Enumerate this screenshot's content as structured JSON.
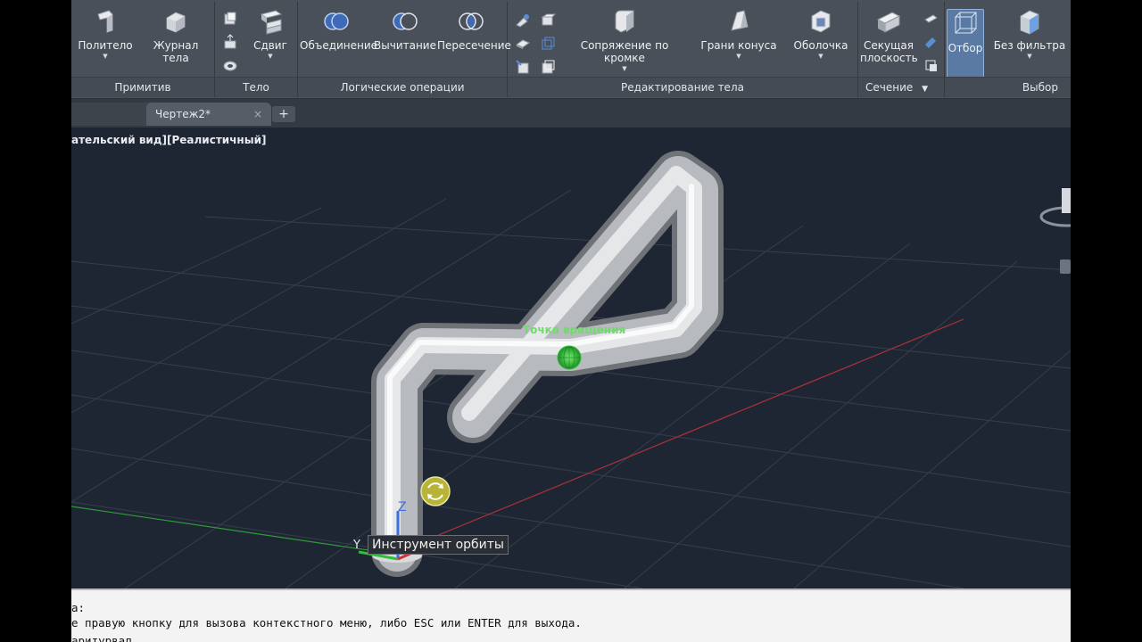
{
  "ribbon": {
    "groups": {
      "primitives": "Примитив",
      "solid": "Тело",
      "boolean": "Логические операции",
      "solid_editing": "Редактирование тела",
      "section": "Сечение",
      "selection": "Выбор"
    },
    "buttons": {
      "polysolid": "Политело",
      "solid_history": "Журнал тела",
      "sweep": "Сдвиг",
      "union": "Объединение",
      "subtract": "Вычитание",
      "intersect": "Пересечение",
      "fillet_edge": "Сопряжение по кромке",
      "taper_faces": "Грани конуса",
      "shell": "Оболочка",
      "section_plane_1": "Секущая",
      "section_plane_2": "плоскость",
      "culling": "Отбор",
      "no_filter": "Без фильтра"
    }
  },
  "tabs": {
    "current": "Чертеж2*",
    "close_glyph": "×",
    "new_glyph": "+"
  },
  "viewport": {
    "label": "ательский вид][Реалистичный]",
    "pivot_label": "Точка вращения",
    "tooltip": "Инструмент орбиты",
    "ucs_z": "Z",
    "ucs_y": "Y",
    "colors": {
      "background": "#1f2633",
      "grid": "#3a4150",
      "x_axis": "#b0303a",
      "y_axis": "#2f9a3a",
      "pivot": "#2fbf3a"
    }
  },
  "command_line": {
    "line1": "а:",
    "line2": "е правую кнопку для вызова контекстного меню, либо ESC или ENTER для выхода.",
    "line3": "аритурвал"
  }
}
